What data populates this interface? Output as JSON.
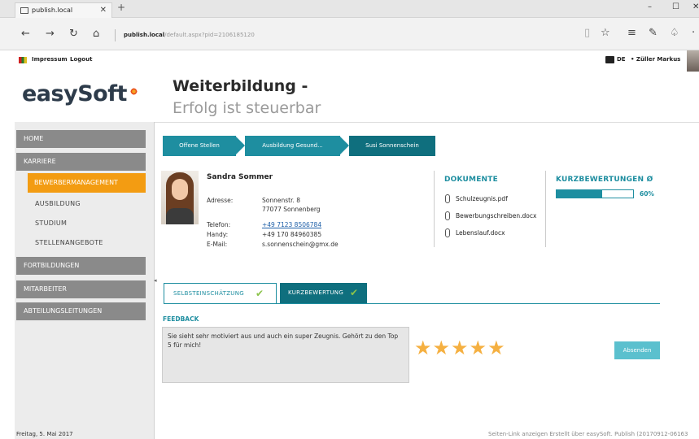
{
  "browser": {
    "tab_title": "publish.local",
    "tab_close": "✕",
    "new_tab": "+",
    "url_host": "publish.local",
    "url_path": "/default.aspx?pid=2106185120",
    "controls": {
      "minimize": "–",
      "maximize": "☐",
      "close": "✕"
    }
  },
  "topbar": {
    "impressum": "Impressum",
    "logout": "Logout",
    "language": "DE",
    "user": "• Züller Markus"
  },
  "logo": {
    "text": "easySoft"
  },
  "headline": {
    "line1": "Weiterbildung -",
    "line2": "Erfolg ist steuerbar"
  },
  "sidebar": {
    "home": "HOME",
    "karriere": "KARRIERE",
    "bewerbermanagement": "BEWERBERMANAGEMENT",
    "ausbildung": "AUSBILDUNG",
    "studium": "STUDIUM",
    "stellenangebote": "STELLENANGEBOTE",
    "fortbildungen": "FORTBILDUNGEN",
    "mitarbeiter": "MITARBEITER",
    "abteilungsleitungen": "ABTEILUNGSLEITUNGEN"
  },
  "breadcrumb": [
    "Offene Stellen",
    "Ausbildung Gesund...",
    "Susi Sonnenschein"
  ],
  "profile": {
    "name": "Sandra Sommer",
    "address_label": "Adresse:",
    "address_line1": "Sonnenstr. 8",
    "address_line2": "77077 Sonnenberg",
    "phone_label": "Telefon:",
    "phone": "+49 7123 8506784",
    "mobile_label": "Handy:",
    "mobile": "+49 170 84960385",
    "email_label": "E-Mail:",
    "email": "s.sonnenschein@gmx.de"
  },
  "documents": {
    "title": "DOKUMENTE",
    "files": [
      "Schulzeugnis.pdf",
      "Bewerbungschreiben.docx",
      "Lebenslauf.docx"
    ]
  },
  "rating": {
    "title": "KURZBEWERTUNGEN Ø",
    "progress": 0.6,
    "percent": "60%"
  },
  "tabs": {
    "self": "SELBSTEINSCHÄTZUNG",
    "short": "KURZBEWERTUNG"
  },
  "feedback": {
    "label": "FEEDBACK",
    "text": "Sie sieht sehr motiviert aus und auch ein super Zeugnis. Gehört zu den Top 5 für mich!",
    "stars": "★★★★★",
    "stars_value": 5,
    "submit": "Absenden"
  },
  "footer": {
    "date": "Freitag, 5. Mai 2017",
    "right": "Seiten-Link anzeigen Erstellt über easySoft. Publish (20170912-06163"
  },
  "colors": {
    "teal": "#1e8ea0",
    "dark_teal": "#0f6f7e",
    "orange": "#f39c12",
    "star": "#f5b041",
    "check": "#8bc34a"
  }
}
